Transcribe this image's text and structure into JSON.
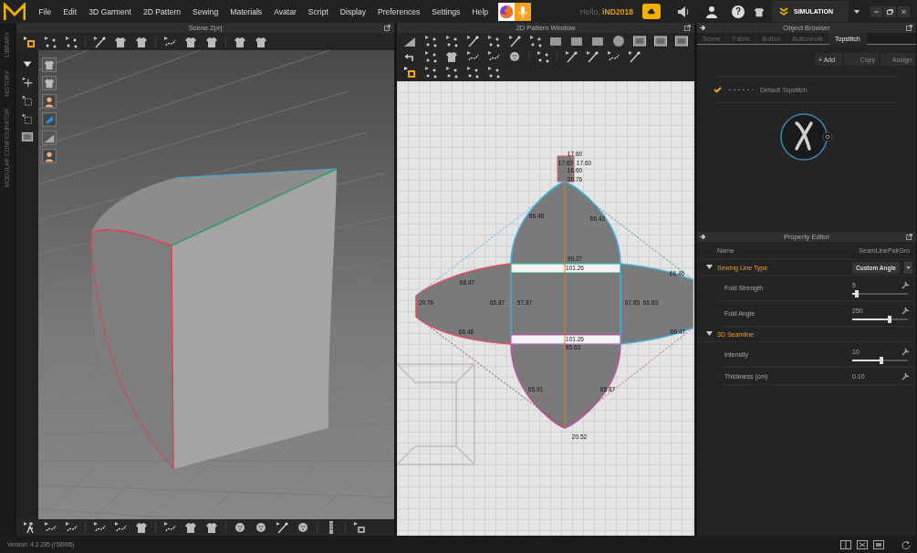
{
  "menu": [
    "File",
    "Edit",
    "3D Garment",
    "2D Pattern",
    "Sewing",
    "Materials",
    "Avatar",
    "Script",
    "Display",
    "Preferences",
    "Settings",
    "Help"
  ],
  "user": {
    "greeting": "Hello,",
    "name": "iND2018"
  },
  "help_button": "?",
  "mode": {
    "label": "SIMULATION"
  },
  "side_tabs": [
    "LIBRARY",
    "HISTORY",
    "MODULAR CONFIGURATOR"
  ],
  "scene_window": {
    "title": "Scene.Zprj"
  },
  "pattern_window": {
    "title": "2D Pattern Window",
    "measurements": [
      "17.60",
      "17.60",
      "17.60",
      "16.60",
      "20.76",
      "66.46",
      "66.43",
      "66.47",
      "99.27",
      "101.26",
      "66.46",
      "20.76",
      "65.87",
      "57.87",
      "67.85",
      "66.83",
      "66.46",
      "66.47",
      "101.26",
      "95.63",
      "65.91",
      "65.87",
      "20.52"
    ]
  },
  "object_browser": {
    "title": "Object Browser",
    "tabs": [
      {
        "label": "Scene",
        "selected": false
      },
      {
        "label": "Fabric",
        "selected": false
      },
      {
        "label": "Button",
        "selected": false
      },
      {
        "label": "Buttonhole",
        "selected": false
      },
      {
        "label": "Topstitch",
        "selected": true
      }
    ],
    "buttons": [
      {
        "label": "+ Add",
        "disabled": false
      },
      {
        "label": "Copy",
        "disabled": true
      },
      {
        "label": "Assign",
        "disabled": true
      }
    ],
    "items": [
      {
        "name": "Default Topstitch",
        "checked": true
      }
    ]
  },
  "property_editor": {
    "title": "Property Editor",
    "name_label": "Name",
    "name_value": "SeamLinePairGro",
    "sections": [
      {
        "title": "Sewing Line Type",
        "expanded": true,
        "value": "Custom Angle",
        "rows": [
          {
            "kind": "slider",
            "label": "Fold Strength",
            "value": "5",
            "level": 0.08
          },
          {
            "kind": "slider",
            "label": "Fold Angle",
            "value": "250",
            "level": 0.68
          }
        ]
      },
      {
        "title": "3D Seamline",
        "expanded": true,
        "rows": [
          {
            "kind": "slider",
            "label": "Intensity",
            "value": "10",
            "level": 0.52
          },
          {
            "kind": "number",
            "label": "Thickness (cm)",
            "value": "0.10"
          }
        ]
      }
    ]
  },
  "status_bar": {
    "version": "Version: 4.2.295 (r38995)"
  }
}
